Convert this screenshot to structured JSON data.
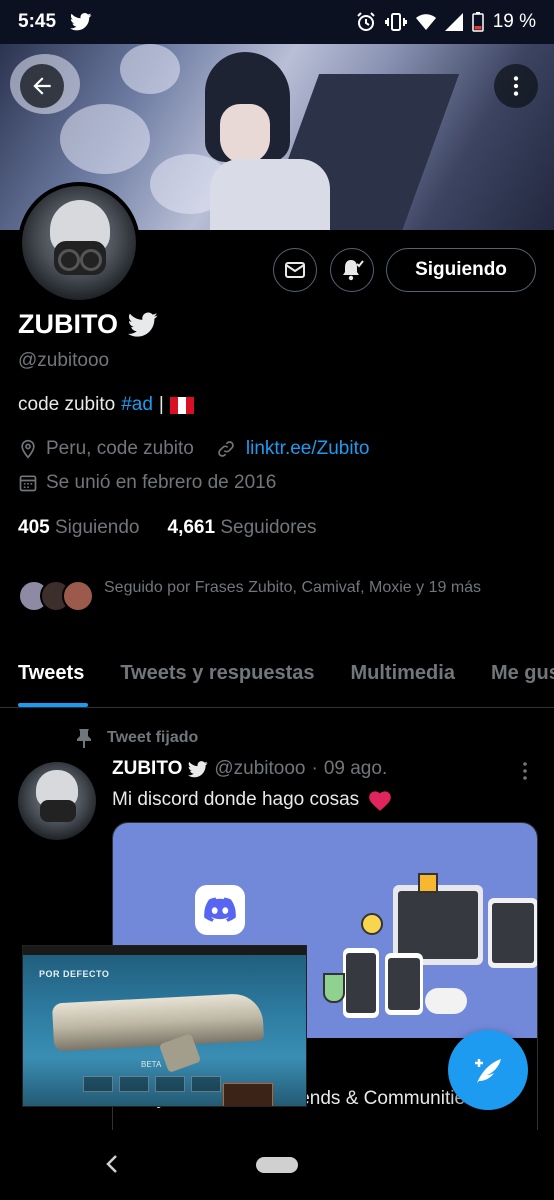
{
  "status_bar": {
    "time": "5:45",
    "battery": "19 %"
  },
  "profile": {
    "follow_button": "Siguiendo",
    "name": "ZUBITO",
    "handle": "@zubitooo",
    "bio_prefix": "code zubito",
    "bio_hashtag": "#ad",
    "bio_separator": "|",
    "location": "Peru, code zubito",
    "website": "linktr.ee/Zubito",
    "joined": "Se unió en febrero de 2016",
    "following_count": "405",
    "following_label": "Siguiendo",
    "followers_count": "4,661",
    "followers_label": "Seguidores",
    "followed_by": "Seguido por Frases Zubito, Camivaf, Moxie y 19 más"
  },
  "tabs": [
    {
      "label": "Tweets"
    },
    {
      "label": "Tweets y respuestas"
    },
    {
      "label": "Multimedia"
    },
    {
      "label": "Me gusta"
    }
  ],
  "pinned_tweet": {
    "pinned_label": "Tweet fijado",
    "author": "ZUBITO",
    "handle": "@zubitooo",
    "separator": "·",
    "date": "09 ago.",
    "text": "Mi discord donde hago cosas",
    "card_title": "... ay to Chat with Friends & Communities"
  },
  "pip_video": {
    "title": "POR DEFECTO",
    "badge": "BETA"
  },
  "colors": {
    "accent": "#1d9bf0",
    "background": "#000000",
    "secondary_text": "#71767b",
    "discord": "#7289da"
  }
}
